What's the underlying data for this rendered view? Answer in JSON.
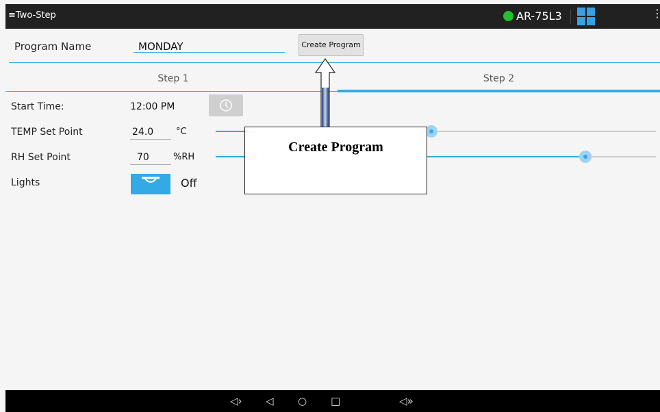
{
  "topbar": {
    "title": "≡Two-Step",
    "device_name": "AR-75L3",
    "status_color": "#23c02f",
    "overflow_icon": "⋮"
  },
  "form": {
    "program_name_label": "Program Name",
    "program_name_value": "MONDAY",
    "create_button_label": "Create Program"
  },
  "tabs": [
    {
      "label": "Step 1"
    },
    {
      "label": "Step 2",
      "selected": true
    }
  ],
  "settings": {
    "start_time_label": "Start Time:",
    "start_time_value": "12:00 PM",
    "temp_label": "TEMP Set Point",
    "temp_value": "24.0",
    "temp_unit": "°C",
    "temp_level": 0.49,
    "rh_label": "RH Set Point",
    "rh_value": "70",
    "rh_unit": "%RH",
    "rh_level": 0.84,
    "lights_label": "Lights",
    "lights_state": "Off"
  },
  "annotation": {
    "callout_text": "Create Program"
  },
  "navbar": {
    "icons": [
      "volume-down-icon",
      "back-icon",
      "home-icon",
      "recents-icon",
      "volume-up-icon"
    ],
    "glyphs": [
      "◁›",
      "◁",
      "○",
      "□",
      "◁»"
    ]
  },
  "colors": {
    "accent": "#33a9e6",
    "topbar": "#212121",
    "navbar": "#000000"
  }
}
